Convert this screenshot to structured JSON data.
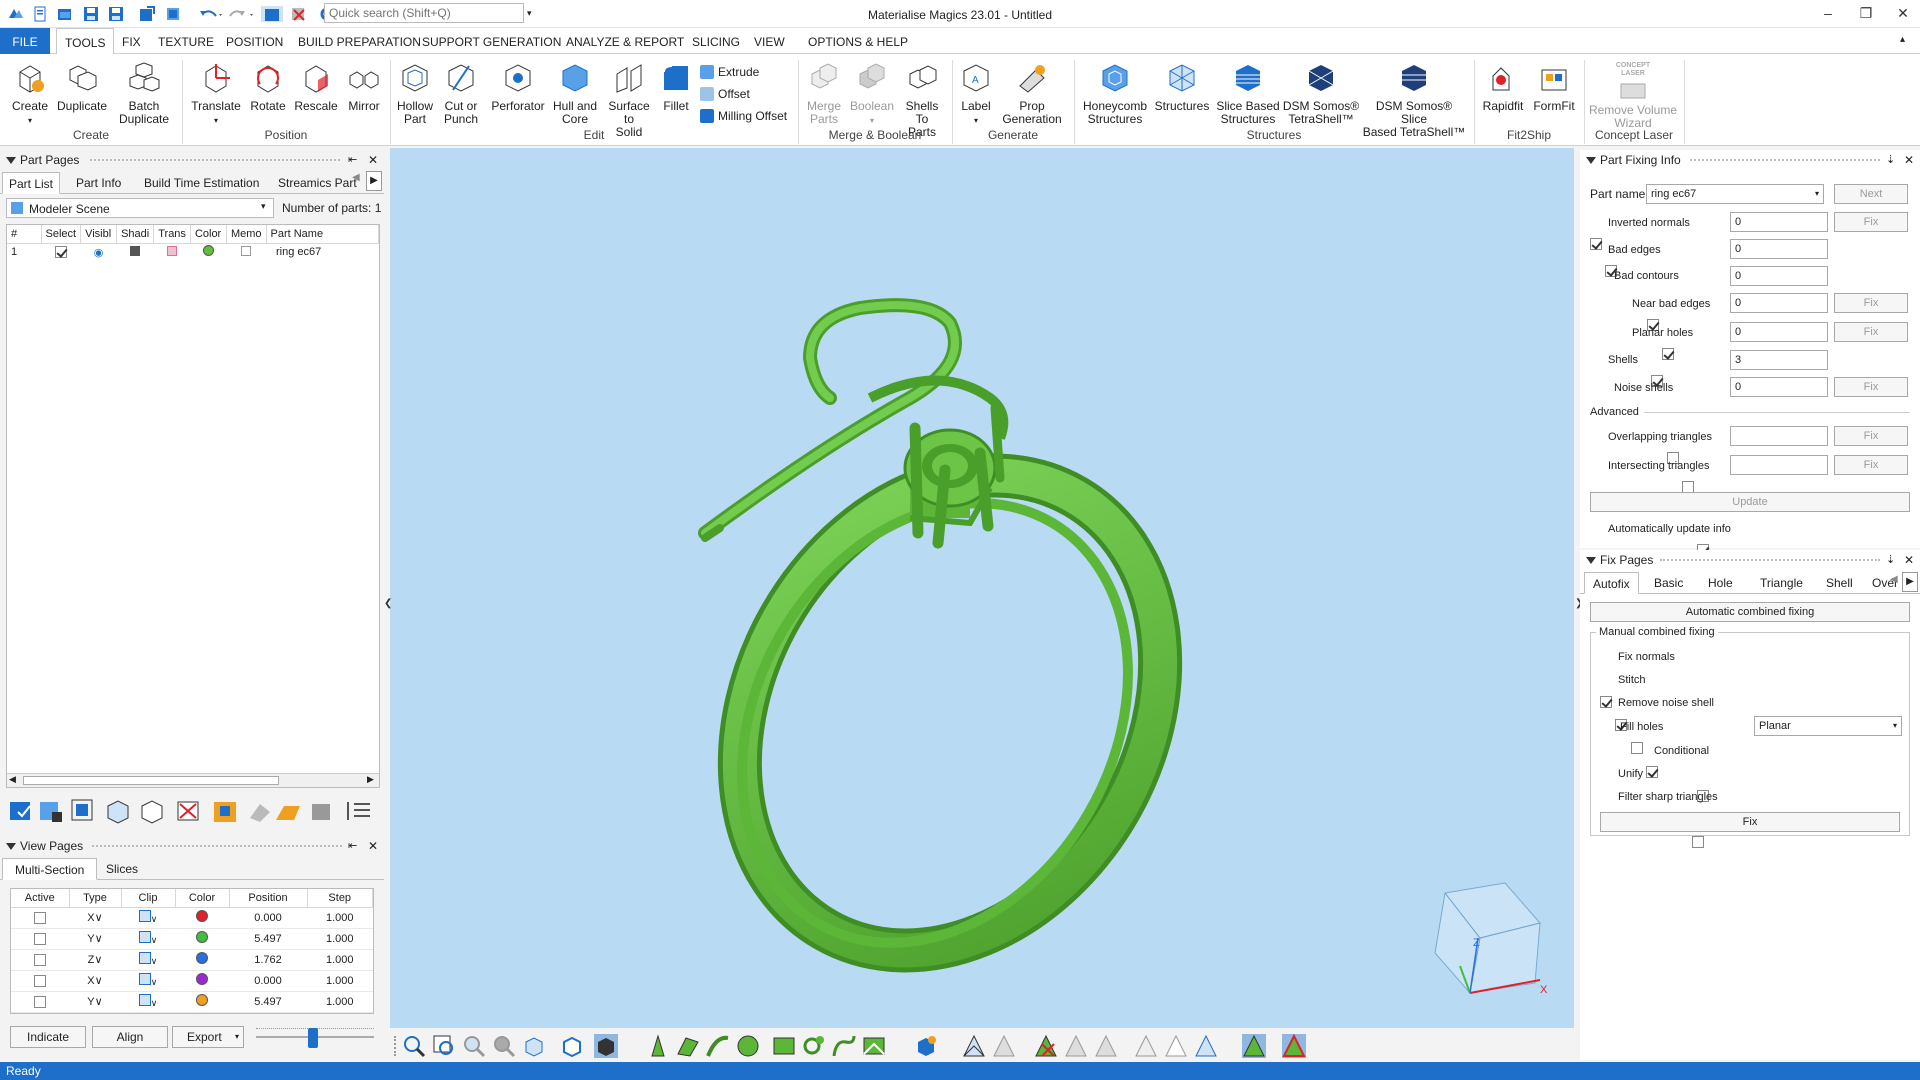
{
  "window": {
    "title": "Materialise Magics 23.01 - Untitled",
    "search_placeholder": "Quick search (Shift+Q)"
  },
  "menu": [
    "FILE",
    "TOOLS",
    "FIX",
    "TEXTURE",
    "POSITION",
    "BUILD PREPARATION",
    "SUPPORT GENERATION",
    "ANALYZE & REPORT",
    "SLICING",
    "VIEW",
    "OPTIONS & HELP"
  ],
  "ribbon": {
    "create": {
      "create": "Create",
      "duplicate": "Duplicate",
      "batch_duplicate_1": "Batch",
      "batch_duplicate_2": "Duplicate",
      "group": "Create"
    },
    "position": {
      "translate": "Translate",
      "rotate": "Rotate",
      "rescale": "Rescale",
      "mirror": "Mirror",
      "group": "Position"
    },
    "edit": {
      "hollow_1": "Hollow",
      "hollow_2": "Part",
      "cut_1": "Cut or",
      "cut_2": "Punch",
      "perforator": "Perforator",
      "hull_1": "Hull and",
      "hull_2": "Core",
      "surface_1": "Surface to",
      "surface_2": "Solid",
      "fillet": "Fillet",
      "extrude": "Extrude",
      "offset": "Offset",
      "milling_offset": "Milling Offset",
      "group": "Edit"
    },
    "merge": {
      "merge_1": "Merge",
      "merge_2": "Parts",
      "boolean": "Boolean",
      "shells_1": "Shells To",
      "shells_2": "Parts",
      "group": "Merge & Boolean"
    },
    "generate": {
      "label": "Label",
      "prop_1": "Prop",
      "prop_2": "Generation",
      "group": "Generate"
    },
    "structures": {
      "honeycomb_1": "Honeycomb",
      "honeycomb_2": "Structures",
      "structures": "Structures",
      "slice_1": "Slice Based",
      "slice_2": "Structures",
      "dsm1_1": "DSM Somos®",
      "dsm1_2": "TetraShell™",
      "dsm2_1": "DSM Somos® Slice",
      "dsm2_2": "Based TetraShell™",
      "group": "Structures"
    },
    "fit2ship": {
      "rapidfit": "Rapidfit",
      "formfit": "FormFit",
      "group": "Fit2Ship"
    },
    "laser": {
      "concept": "CONCEPT",
      "laser": "LASER",
      "remove_1": "Remove Volume",
      "remove_2": "Wizard",
      "group": "Concept Laser"
    }
  },
  "part_pages": {
    "title": "Part Pages",
    "tabs": [
      "Part List",
      "Part Info",
      "Build Time Estimation",
      "Streamics Part"
    ],
    "scene": "Modeler Scene",
    "num_parts_label": "Number of parts:",
    "num_parts": "1",
    "columns": [
      "#",
      "Select",
      "Visibl",
      "Shadi",
      "Trans",
      "Color",
      "Memo",
      "Part Name"
    ],
    "rows": [
      {
        "num": "1",
        "name": "ring ec67",
        "color": "#5fbf3a"
      }
    ]
  },
  "view_pages": {
    "title": "View Pages",
    "tabs": [
      "Multi-Section",
      "Slices"
    ],
    "columns": [
      "Active",
      "Type",
      "Clip",
      "Color",
      "Position",
      "Step"
    ],
    "rows": [
      {
        "type": "X∨",
        "color": "#e0202a",
        "position": "0.000",
        "step": "1.000"
      },
      {
        "type": "Y∨",
        "color": "#3fbf3a",
        "position": "5.497",
        "step": "1.000"
      },
      {
        "type": "Z∨",
        "color": "#2a6fe0",
        "position": "1.762",
        "step": "1.000"
      },
      {
        "type": "X∨",
        "color": "#9a2ad0",
        "position": "0.000",
        "step": "1.000"
      },
      {
        "type": "Y∨",
        "color": "#f0a020",
        "position": "5.497",
        "step": "1.000"
      }
    ],
    "buttons": {
      "indicate": "Indicate",
      "align": "Align",
      "export": "Export"
    }
  },
  "part_fixing": {
    "title": "Part Fixing Info",
    "part_name_label": "Part name",
    "part_name": "ring ec67",
    "next": "Next",
    "fix": "Fix",
    "items": {
      "inverted_normals": {
        "label": "Inverted normals",
        "value": "0"
      },
      "bad_edges": {
        "label": "Bad edges",
        "value": "0"
      },
      "bad_contours": {
        "label": "Bad contours",
        "value": "0"
      },
      "near_bad_edges": {
        "label": "Near bad edges",
        "value": "0"
      },
      "planar_holes": {
        "label": "Planar holes",
        "value": "0"
      },
      "shells": {
        "label": "Shells",
        "value": "3"
      },
      "noise_shells": {
        "label": "Noise shells",
        "value": "0"
      }
    },
    "advanced": "Advanced",
    "overlapping": "Overlapping triangles",
    "intersecting": "Intersecting triangles",
    "update": "Update",
    "auto_update": "Automatically update info"
  },
  "fix_pages": {
    "title": "Fix Pages",
    "tabs": [
      "Autofix",
      "Basic",
      "Hole",
      "Triangle",
      "Shell",
      "Over"
    ],
    "auto_combined": "Automatic combined fixing",
    "manual_title": "Manual combined fixing",
    "fix_normals": "Fix normals",
    "stitch": "Stitch",
    "remove_noise": "Remove noise shell",
    "fill_holes": "Fill holes",
    "fill_mode": "Planar",
    "conditional": "Conditional",
    "unify": "Unify",
    "filter_sharp": "Filter sharp triangles",
    "fix": "Fix"
  },
  "status": "Ready",
  "colors": {
    "accent": "#1e6fc9",
    "viewport_bg": "#b9daf3",
    "part": "#5fbf3a"
  }
}
